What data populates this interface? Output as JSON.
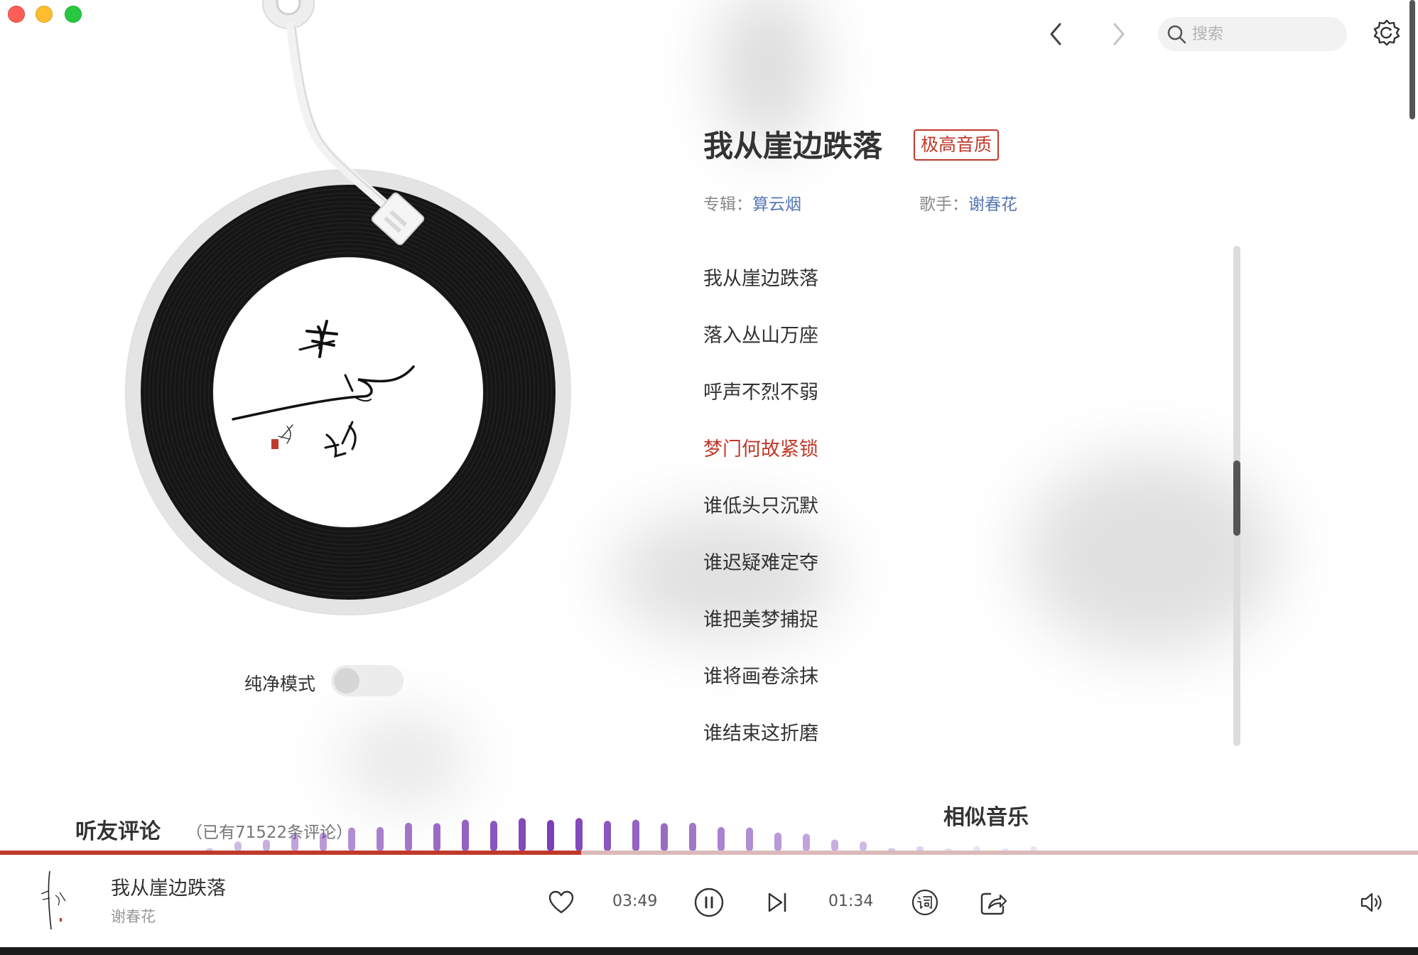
{
  "window": {
    "scrollbar": true
  },
  "topbar": {
    "search_placeholder": "搜索",
    "back_icon": "chevron-left-icon",
    "forward_icon": "chevron-right-icon",
    "settings_icon": "settings-icon"
  },
  "song": {
    "title": "我从崖边跌落",
    "quality_badge": "极高音质",
    "album_label": "专辑：",
    "album": "算云烟",
    "artist_label": "歌手：",
    "artist": "谢春花"
  },
  "record": {
    "label_art": "album-calligraphy-art"
  },
  "pure_mode": {
    "label": "纯净模式",
    "enabled": false
  },
  "lyrics": {
    "lines": [
      "我从崖边跌落",
      "落入丛山万座",
      "呼声不烈不弱",
      "梦门何故紧锁",
      "谁低头只沉默",
      "谁迟疑难定夺",
      "谁把美梦捕捉",
      "谁将画卷涂抹",
      "谁结束这折磨"
    ],
    "current_index": 3
  },
  "comments": {
    "title": "听友评论",
    "count_text": "（已有71522条评论）"
  },
  "similar": {
    "title": "相似音乐"
  },
  "player": {
    "title": "我从崖边跌落",
    "artist": "谢春花",
    "elapsed": "03:49",
    "remaining": "01:34",
    "progress": 0.41,
    "colors": {
      "accent": "#c0392b",
      "visualizer": "#7b3fb5"
    }
  }
}
